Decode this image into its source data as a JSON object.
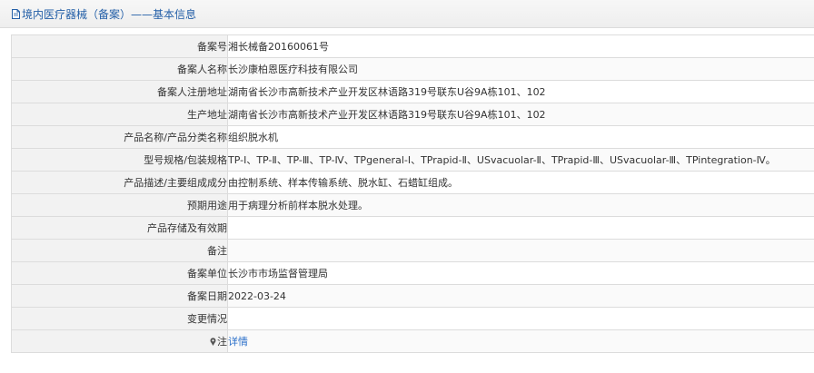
{
  "header": {
    "title": "境内医疗器械（备案）——基本信息",
    "icon": "document-icon"
  },
  "rows": [
    {
      "label": "备案号",
      "value": "湘长械备20160061号"
    },
    {
      "label": "备案人名称",
      "value": "长沙康柏恩医疗科技有限公司"
    },
    {
      "label": "备案人注册地址",
      "value": "湖南省长沙市高新技术产业开发区林语路319号联东U谷9A栋101、102"
    },
    {
      "label": "生产地址",
      "value": "湖南省长沙市高新技术产业开发区林语路319号联东U谷9A栋101、102"
    },
    {
      "label": "产品名称/产品分类名称",
      "value": "组织脱水机"
    },
    {
      "label": "型号规格/包装规格",
      "value": "TP-Ⅰ、TP-Ⅱ、TP-Ⅲ、TP-Ⅳ、TPgeneral-Ⅰ、TPrapid-Ⅱ、USvacuolar-Ⅱ、TPrapid-Ⅲ、USvacuolar-Ⅲ、TPintegration-Ⅳ。"
    },
    {
      "label": "产品描述/主要组成成分",
      "value": "由控制系统、样本传输系统、脱水缸、石蜡缸组成。"
    },
    {
      "label": "预期用途",
      "value": "用于病理分析前样本脱水处理。"
    },
    {
      "label": "产品存储及有效期",
      "value": ""
    },
    {
      "label": "备注",
      "value": ""
    },
    {
      "label": "备案单位",
      "value": "长沙市市场监督管理局"
    },
    {
      "label": "备案日期",
      "value": "2022-03-24"
    },
    {
      "label": "变更情况",
      "value": ""
    }
  ],
  "note_row": {
    "label": "注",
    "icon": "pin-icon",
    "link_text": "详情"
  },
  "colors": {
    "title": "#2560a8",
    "link": "#2a6fc9",
    "label_bg": "#f2f2f2",
    "border": "#dcdcdc"
  }
}
